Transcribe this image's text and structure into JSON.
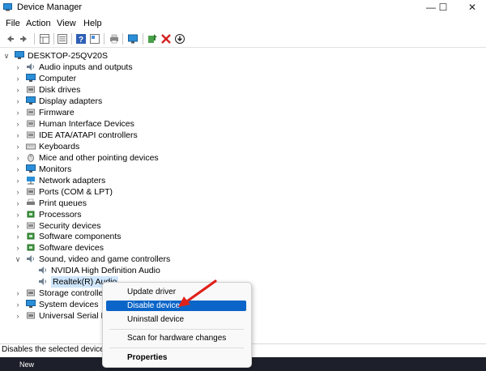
{
  "window": {
    "title": "Device Manager"
  },
  "menu": [
    "File",
    "Action",
    "View",
    "Help"
  ],
  "toolbar_icons": [
    "back-icon",
    "forward-icon",
    "properties-grid-icon",
    "details-icon",
    "help-icon",
    "view-icon",
    "print-icon",
    "monitor-icon",
    "update-driver-icon",
    "uninstall-icon",
    "download-icon"
  ],
  "tree": {
    "root": "DESKTOP-25QV20S",
    "items": [
      {
        "label": "Audio inputs and outputs",
        "icon": "speaker-icon",
        "color": "#6f7f8f"
      },
      {
        "label": "Computer",
        "icon": "computer-icon",
        "color": "#2a8fd8"
      },
      {
        "label": "Disk drives",
        "icon": "disk-icon",
        "color": "#7a7a7a"
      },
      {
        "label": "Display adapters",
        "icon": "display-icon",
        "color": "#2a8fd8"
      },
      {
        "label": "Firmware",
        "icon": "chip-icon",
        "color": "#8a8a8a"
      },
      {
        "label": "Human Interface Devices",
        "icon": "hid-icon",
        "color": "#8a8a8a"
      },
      {
        "label": "IDE ATA/ATAPI controllers",
        "icon": "controller-icon",
        "color": "#8a8a8a"
      },
      {
        "label": "Keyboards",
        "icon": "keyboard-icon",
        "color": "#7a7a7a"
      },
      {
        "label": "Mice and other pointing devices",
        "icon": "mouse-icon",
        "color": "#7a7a7a"
      },
      {
        "label": "Monitors",
        "icon": "monitor-icon",
        "color": "#2a8fd8"
      },
      {
        "label": "Network adapters",
        "icon": "network-icon",
        "color": "#2a8fd8"
      },
      {
        "label": "Ports (COM & LPT)",
        "icon": "port-icon",
        "color": "#7a7a7a"
      },
      {
        "label": "Print queues",
        "icon": "printer-icon",
        "color": "#7a7a7a"
      },
      {
        "label": "Processors",
        "icon": "processor-icon",
        "color": "#3c9a3c"
      },
      {
        "label": "Security devices",
        "icon": "security-icon",
        "color": "#8a8a8a"
      },
      {
        "label": "Software components",
        "icon": "software-icon",
        "color": "#3c9a3c"
      },
      {
        "label": "Software devices",
        "icon": "software-icon",
        "color": "#3c9a3c"
      },
      {
        "label": "Sound, video and game controllers",
        "icon": "speaker-icon",
        "color": "#6f7f8f",
        "expanded": true,
        "children": [
          {
            "label": "NVIDIA High Definition Audio",
            "icon": "speaker-icon",
            "color": "#6f7f8f"
          },
          {
            "label": "Realtek(R) Audio",
            "icon": "speaker-icon",
            "color": "#6f7f8f",
            "selected": true
          }
        ]
      },
      {
        "label": "Storage controllers",
        "icon": "storage-icon",
        "color": "#7a7a7a"
      },
      {
        "label": "System devices",
        "icon": "system-icon",
        "color": "#2a8fd8"
      },
      {
        "label": "Universal Serial Bus",
        "icon": "usb-icon",
        "color": "#7a7a7a"
      }
    ]
  },
  "context_menu": {
    "items": [
      "Update driver",
      "Disable device",
      "Uninstall device",
      "Scan for hardware changes",
      "Properties"
    ],
    "highlighted": "Disable device"
  },
  "status": {
    "text": "Disables the selected device."
  },
  "taskbar": {
    "text": "New"
  },
  "colors": {
    "highlight": "#0b65c8",
    "selection": "#cfe6fb",
    "arrow": "#e0201b"
  }
}
